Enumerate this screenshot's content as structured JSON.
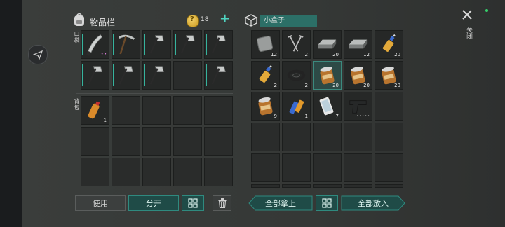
{
  "inventory": {
    "title": "物品栏",
    "coins": "18",
    "pocket_label": "口袋",
    "backpack_label": "背包",
    "pocket_slots": [
      {
        "item": "machete-icon",
        "qty": "",
        "bar": true,
        "dots": true
      },
      {
        "item": "pickaxe-icon",
        "qty": "",
        "bar": true
      },
      {
        "item": "hatchet-icon",
        "qty": "",
        "bar": true
      },
      {
        "item": "hatchet-icon",
        "qty": "",
        "bar": true
      },
      {
        "item": "hatchet-icon",
        "qty": "",
        "bar": true
      },
      {
        "item": "hatchet-icon",
        "qty": "",
        "bar": true
      },
      {
        "item": "hatchet-icon",
        "qty": "",
        "bar": true
      },
      {
        "item": "hatchet-icon",
        "qty": "",
        "bar": true
      },
      {
        "item": "",
        "qty": "",
        "bar": false
      },
      {
        "item": "hatchet-icon",
        "qty": "",
        "bar": true
      }
    ],
    "backpack_slots": [
      {
        "item": "water-bottle-icon",
        "qty": "1"
      },
      {
        "item": "",
        "qty": ""
      },
      {
        "item": "",
        "qty": ""
      },
      {
        "item": "",
        "qty": ""
      },
      {
        "item": "",
        "qty": ""
      },
      {
        "item": "",
        "qty": ""
      },
      {
        "item": "",
        "qty": ""
      },
      {
        "item": "",
        "qty": ""
      },
      {
        "item": "",
        "qty": ""
      },
      {
        "item": "",
        "qty": ""
      },
      {
        "item": "",
        "qty": ""
      },
      {
        "item": "",
        "qty": ""
      },
      {
        "item": "",
        "qty": ""
      },
      {
        "item": "",
        "qty": ""
      },
      {
        "item": "",
        "qty": ""
      }
    ],
    "use_label": "使用",
    "split_label": "分开"
  },
  "box": {
    "title": "小盒子",
    "slots": [
      {
        "item": "metal-plate-icon",
        "qty": "12"
      },
      {
        "item": "nails-icon",
        "qty": "2"
      },
      {
        "item": "iron-ingot-icon",
        "qty": "20"
      },
      {
        "item": "iron-ingot-icon",
        "qty": "12"
      },
      {
        "item": "glue-icon",
        "qty": "20"
      },
      {
        "item": "glue-icon",
        "qty": "2"
      },
      {
        "item": "rubber-ring-icon",
        "qty": "2"
      },
      {
        "item": "canned-food-icon",
        "qty": "20",
        "selected": true
      },
      {
        "item": "canned-food-icon",
        "qty": "20"
      },
      {
        "item": "canned-food-icon",
        "qty": "20"
      },
      {
        "item": "canned-food-icon",
        "qty": "9"
      },
      {
        "item": "battery-icon",
        "qty": "1"
      },
      {
        "item": "smartphone-icon",
        "qty": "7"
      },
      {
        "item": "pistol-icon",
        "qty": "",
        "dots": true
      },
      {
        "item": "",
        "qty": ""
      },
      {
        "item": "",
        "qty": ""
      },
      {
        "item": "",
        "qty": ""
      },
      {
        "item": "",
        "qty": ""
      },
      {
        "item": "",
        "qty": ""
      },
      {
        "item": "",
        "qty": ""
      },
      {
        "item": "",
        "qty": ""
      },
      {
        "item": "",
        "qty": ""
      },
      {
        "item": "",
        "qty": ""
      },
      {
        "item": "",
        "qty": ""
      },
      {
        "item": "",
        "qty": ""
      },
      {
        "item": "",
        "qty": ""
      },
      {
        "item": "",
        "qty": ""
      },
      {
        "item": "",
        "qty": ""
      },
      {
        "item": "",
        "qty": ""
      },
      {
        "item": "",
        "qty": ""
      }
    ],
    "take_all_label": "全部拿上",
    "put_all_label": "全部放入",
    "close_label": "关闭"
  },
  "colors": {
    "accent": "#2f8a7f",
    "teal_fill": "#1f4b47",
    "coin": "#d9aa2c"
  }
}
